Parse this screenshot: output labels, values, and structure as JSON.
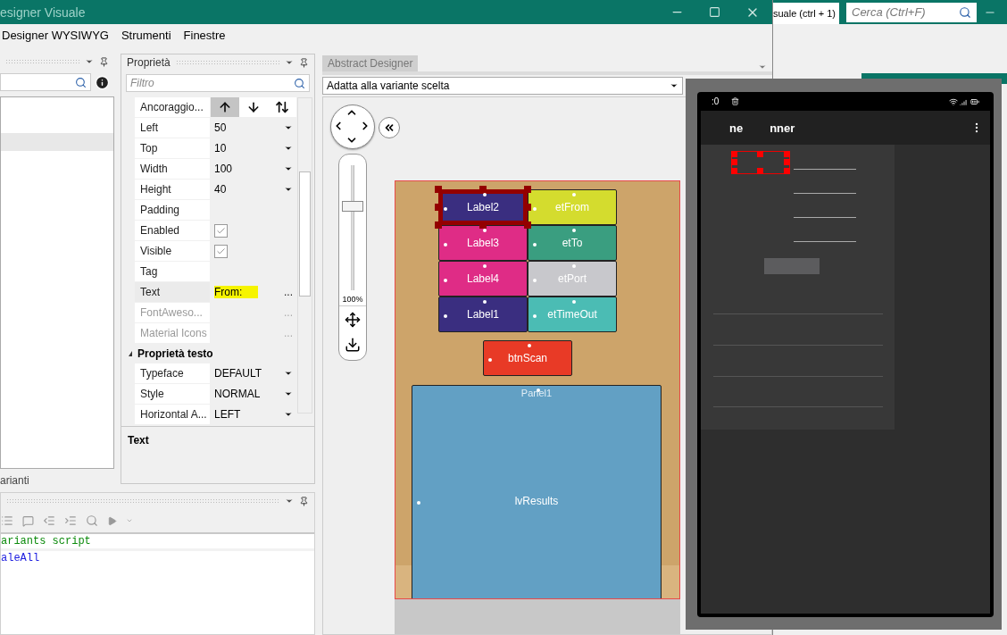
{
  "window": {
    "title": "esigner Visuale"
  },
  "menu": [
    "Designer WYSIWYG",
    "Strumenti",
    "Finestre"
  ],
  "left_panel": {
    "tab": "arianti"
  },
  "properties": {
    "title": "Proprietà",
    "filter_placeholder": "Filtro",
    "rows": [
      {
        "kind": "anchor",
        "name": "Ancoraggio...",
        "selected": false,
        "disabled": false,
        "options": [
          {
            "kind": "up",
            "selected": true
          },
          {
            "kind": "down",
            "selected": false
          },
          {
            "kind": "both",
            "selected": false
          }
        ]
      },
      {
        "kind": "dropdown",
        "name": "Left",
        "value": "50",
        "selected": false,
        "disabled": false
      },
      {
        "kind": "dropdown",
        "name": "Top",
        "value": "10",
        "selected": false,
        "disabled": false
      },
      {
        "kind": "dropdown",
        "name": "Width",
        "value": "100",
        "selected": false,
        "disabled": false
      },
      {
        "kind": "dropdown",
        "name": "Height",
        "value": "40",
        "selected": false,
        "disabled": false
      },
      {
        "kind": "text",
        "name": "Padding",
        "selected": false,
        "disabled": false
      },
      {
        "kind": "checkbox",
        "name": "Enabled",
        "checked": true,
        "selected": false,
        "disabled": false
      },
      {
        "kind": "checkbox",
        "name": "Visible",
        "checked": true,
        "selected": false,
        "disabled": false
      },
      {
        "kind": "text",
        "name": "Tag",
        "selected": false,
        "disabled": false
      },
      {
        "kind": "ellipsis",
        "name": "Text",
        "value": "From:",
        "highlighted": true,
        "button": "...",
        "selected": true,
        "disabled": false
      },
      {
        "kind": "ellipsis",
        "name": "FontAweso...",
        "button": "...",
        "selected": false,
        "disabled": true
      },
      {
        "kind": "ellipsis",
        "name": "Material Icons",
        "button": "...",
        "selected": false,
        "disabled": true
      }
    ],
    "category": {
      "title": "Proprietà testo",
      "expanded": true,
      "rows": [
        {
          "kind": "dropdown",
          "name": "Typeface",
          "value": "DEFAULT",
          "selected": false,
          "disabled": false
        },
        {
          "kind": "dropdown",
          "name": "Style",
          "value": "NORMAL",
          "selected": false,
          "disabled": false
        },
        {
          "kind": "dropdown",
          "name": "Horizontal A...",
          "value": "LEFT",
          "selected": false,
          "disabled": false
        }
      ]
    },
    "description": "Text"
  },
  "code": {
    "lines": [
      {
        "text": "ariants script",
        "kind": "comment"
      },
      {
        "text": "aleAll",
        "kind": "keyword"
      }
    ]
  },
  "designer": {
    "tab": "Abstract Designer",
    "tab_selected": true,
    "variant": "Adatta alla variante scelta",
    "zoom": {
      "level": 0.69,
      "reading": "100%"
    },
    "grid_views": [
      {
        "name": "Label2",
        "color": "#3a2e80",
        "selected": true
      },
      {
        "name": "etFrom",
        "color": "#d4dc2e",
        "selected": false
      },
      {
        "name": "Label3",
        "color": "#df2c86",
        "selected": false
      },
      {
        "name": "etTo",
        "color": "#3a9e80",
        "selected": false
      },
      {
        "name": "Label4",
        "color": "#df2c86",
        "selected": false
      },
      {
        "name": "etPort",
        "color": "#c8c8cc",
        "selected": false
      },
      {
        "name": "Label1",
        "color": "#3a2e80",
        "selected": false
      },
      {
        "name": "etTimeOut",
        "color": "#4bbcb4",
        "selected": false
      }
    ],
    "button": {
      "name": "btnScan",
      "color": "#e83a26"
    },
    "panel": {
      "name": "Panel1"
    },
    "list": {
      "name": "lvResults",
      "color": "#62a0c4"
    }
  },
  "background_window": {
    "tab": "suale  (ctrl + 1)",
    "search_placeholder": "Cerca (Ctrl+F)"
  },
  "emulator": {
    "time": ":0",
    "title_parts": [
      "ne",
      "nner"
    ]
  }
}
